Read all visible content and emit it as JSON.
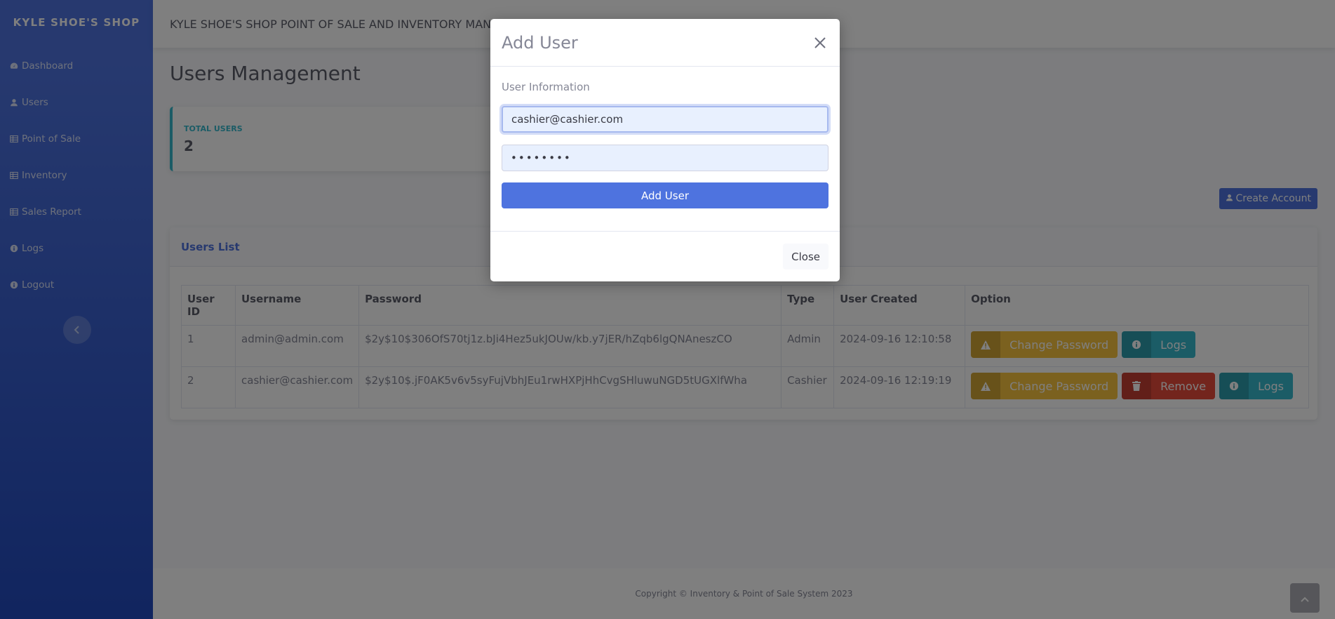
{
  "sidebar": {
    "brand": "KYLE SHOE'S SHOP",
    "items": [
      {
        "label": "Dashboard",
        "icon": "dashboard-icon"
      },
      {
        "label": "Users",
        "icon": "user-icon"
      },
      {
        "label": "Point of Sale",
        "icon": "table-icon"
      },
      {
        "label": "Inventory",
        "icon": "table-icon"
      },
      {
        "label": "Sales Report",
        "icon": "table-icon"
      },
      {
        "label": "Logs",
        "icon": "info-icon"
      },
      {
        "label": "Logout",
        "icon": "info-icon"
      }
    ]
  },
  "topbar": {
    "title": "KYLE SHOE'S SHOP POINT OF SALE AND INVENTORY MANAGEMENT SYSTEM"
  },
  "main": {
    "page_title": "Users Management",
    "stat": {
      "label": "TOTAL USERS",
      "value": "2"
    },
    "create_button": "Create Account",
    "users_list_title": "Users List",
    "table": {
      "headers": [
        "User ID",
        "Username",
        "Password",
        "Type",
        "User Created",
        "Option"
      ],
      "rows": [
        {
          "id": "1",
          "username": "admin@admin.com",
          "password": "$2y$10$306OfS70tj1z.bJi4Hez5ukJOUw/kb.y7jER/hZqb6lgQNAneszCO",
          "type": "Admin",
          "created": "2024-09-16 12:10:58"
        },
        {
          "id": "2",
          "username": "cashier@cashier.com",
          "password": "$2y$10$.jF0AK5v6v5syFujVbhJEu1rwHXPjHhCvgSHluwuNGD5tUGXlfWha",
          "type": "Cashier",
          "created": "2024-09-16 12:19:19"
        }
      ],
      "buttons": {
        "change_password": "Change Password",
        "remove": "Remove",
        "logs": "Logs"
      }
    }
  },
  "footer": {
    "copyright": "Copyright © Inventory & Point of Sale System 2023"
  },
  "modal": {
    "title": "Add User",
    "section_label": "User Information",
    "email_value": "cashier@cashier.com",
    "password_value": "••••••••",
    "add_button": "Add User",
    "close_button": "Close"
  },
  "colors": {
    "primary": "#4e73df",
    "warning": "#f6c23e",
    "danger": "#e74a3b",
    "info": "#36b9cc"
  }
}
